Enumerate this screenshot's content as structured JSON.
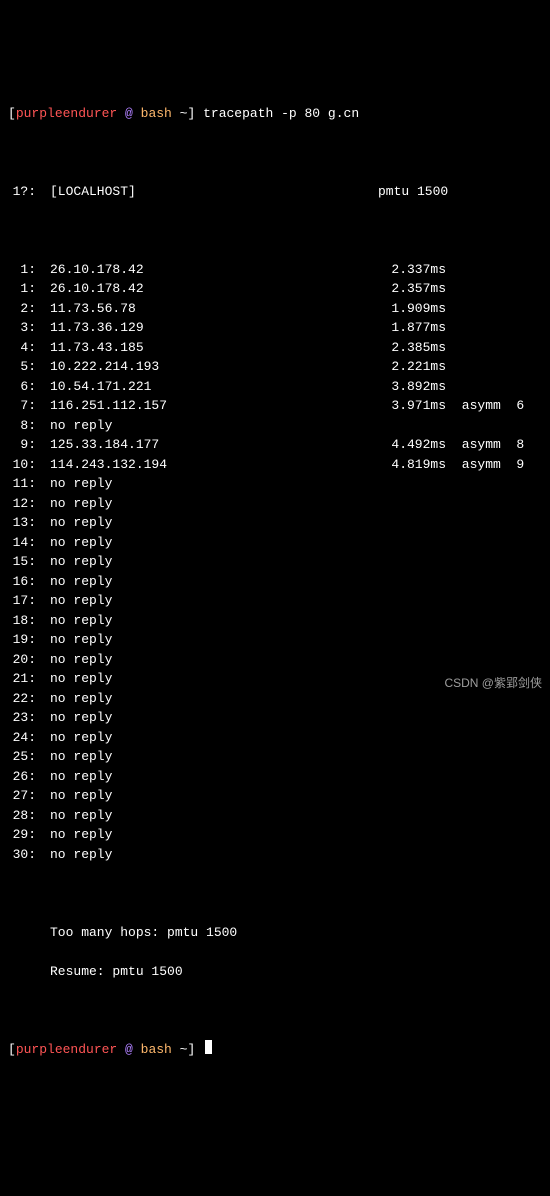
{
  "prompt": {
    "open": "[",
    "user": "purpleendurer",
    "at": " @ ",
    "shell": "bash",
    "tilde": " ~",
    "close": "]",
    "command": "tracepath -p 80 g.cn"
  },
  "header": {
    "hop": "1?:",
    "host": "[LOCALHOST]",
    "pmtu": "pmtu 1500"
  },
  "hops": [
    {
      "n": "1:",
      "addr": "26.10.178.42",
      "rtt": "2.337ms",
      "extra": ""
    },
    {
      "n": "1:",
      "addr": "26.10.178.42",
      "rtt": "2.357ms",
      "extra": ""
    },
    {
      "n": "2:",
      "addr": "11.73.56.78",
      "rtt": "1.909ms",
      "extra": ""
    },
    {
      "n": "3:",
      "addr": "11.73.36.129",
      "rtt": "1.877ms",
      "extra": ""
    },
    {
      "n": "4:",
      "addr": "11.73.43.185",
      "rtt": "2.385ms",
      "extra": ""
    },
    {
      "n": "5:",
      "addr": "10.222.214.193",
      "rtt": "2.221ms",
      "extra": ""
    },
    {
      "n": "6:",
      "addr": "10.54.171.221",
      "rtt": "3.892ms",
      "extra": ""
    },
    {
      "n": "7:",
      "addr": "116.251.112.157",
      "rtt": "3.971ms",
      "extra": "asymm  6"
    },
    {
      "n": "8:",
      "addr": "no reply",
      "rtt": "",
      "extra": ""
    },
    {
      "n": "9:",
      "addr": "125.33.184.177",
      "rtt": "4.492ms",
      "extra": "asymm  8"
    },
    {
      "n": "10:",
      "addr": "114.243.132.194",
      "rtt": "4.819ms",
      "extra": "asymm  9"
    },
    {
      "n": "11:",
      "addr": "no reply",
      "rtt": "",
      "extra": ""
    },
    {
      "n": "12:",
      "addr": "no reply",
      "rtt": "",
      "extra": ""
    },
    {
      "n": "13:",
      "addr": "no reply",
      "rtt": "",
      "extra": ""
    },
    {
      "n": "14:",
      "addr": "no reply",
      "rtt": "",
      "extra": ""
    },
    {
      "n": "15:",
      "addr": "no reply",
      "rtt": "",
      "extra": ""
    },
    {
      "n": "16:",
      "addr": "no reply",
      "rtt": "",
      "extra": ""
    },
    {
      "n": "17:",
      "addr": "no reply",
      "rtt": "",
      "extra": ""
    },
    {
      "n": "18:",
      "addr": "no reply",
      "rtt": "",
      "extra": ""
    },
    {
      "n": "19:",
      "addr": "no reply",
      "rtt": "",
      "extra": ""
    },
    {
      "n": "20:",
      "addr": "no reply",
      "rtt": "",
      "extra": ""
    },
    {
      "n": "21:",
      "addr": "no reply",
      "rtt": "",
      "extra": ""
    },
    {
      "n": "22:",
      "addr": "no reply",
      "rtt": "",
      "extra": ""
    },
    {
      "n": "23:",
      "addr": "no reply",
      "rtt": "",
      "extra": ""
    },
    {
      "n": "24:",
      "addr": "no reply",
      "rtt": "",
      "extra": ""
    },
    {
      "n": "25:",
      "addr": "no reply",
      "rtt": "",
      "extra": ""
    },
    {
      "n": "26:",
      "addr": "no reply",
      "rtt": "",
      "extra": ""
    },
    {
      "n": "27:",
      "addr": "no reply",
      "rtt": "",
      "extra": ""
    },
    {
      "n": "28:",
      "addr": "no reply",
      "rtt": "",
      "extra": ""
    },
    {
      "n": "29:",
      "addr": "no reply",
      "rtt": "",
      "extra": ""
    },
    {
      "n": "30:",
      "addr": "no reply",
      "rtt": "",
      "extra": ""
    }
  ],
  "footer": {
    "toomany": "Too many hops: pmtu 1500",
    "resume": "Resume: pmtu 1500"
  },
  "watermark": "CSDN @紫郢剑侠"
}
